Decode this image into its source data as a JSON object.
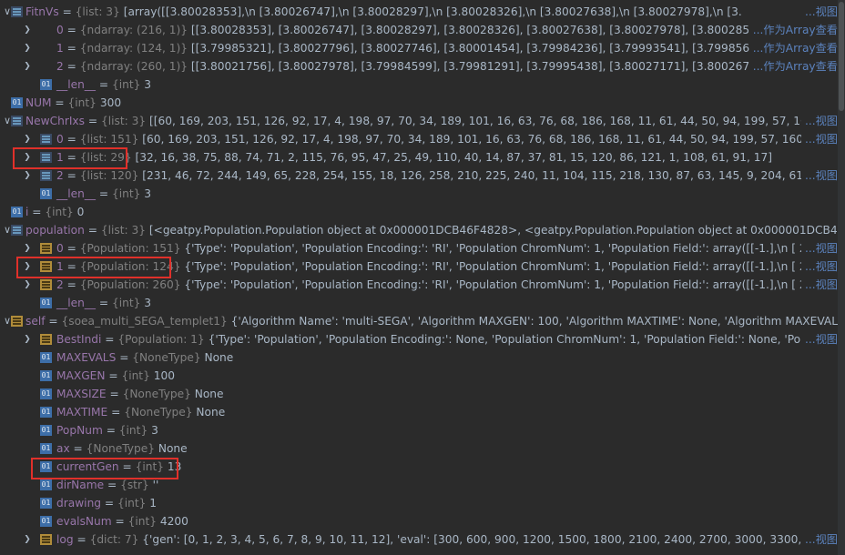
{
  "rows": [
    {
      "indent": 0,
      "expanded": true,
      "icon": "list",
      "name": "FitnVs",
      "type": "{list: 3}",
      "value": "[array([[3.80028353],\\n         [3.80026747],\\n         [3.80028297],\\n         [3.80028326],\\n         [3.80027638],\\n         [3.80027978],\\n         [3.",
      "link": "...视图"
    },
    {
      "indent": 1,
      "expanded": false,
      "icon": "array",
      "name": "0",
      "type": "{ndarray: (216, 1)}",
      "value": "[[3.80028353], [3.80026747], [3.80028297], [3.80028326], [3.80027638], [3.80027978], [3.80028574], [3.8002672",
      "link": "...作为Array查看"
    },
    {
      "indent": 1,
      "expanded": false,
      "icon": "array",
      "name": "1",
      "type": "{ndarray: (124, 1)}",
      "value": "[[3.79985321], [3.80027796], [3.80027746], [3.80001454], [3.79984236], [3.79993541], [3.7998568 ], [3.7999021 ]",
      "link": "...作为Array查看"
    },
    {
      "indent": 1,
      "expanded": false,
      "icon": "array",
      "name": "2",
      "type": "{ndarray: (260, 1)}",
      "value": "[[3.80021756], [3.80027978], [3.79984599], [3.79981291], [3.79995438], [3.80027171], [3.80026747], [3.80002302",
      "link": "...作为Array查看"
    },
    {
      "indent": 1,
      "expanded": null,
      "icon": "int",
      "name": "__len__",
      "type": "{int}",
      "value": "3",
      "link": ""
    },
    {
      "indent": 0,
      "expanded": null,
      "icon": "int",
      "name": "NUM",
      "type": "{int}",
      "value": "300",
      "link": ""
    },
    {
      "indent": 0,
      "expanded": true,
      "icon": "list",
      "name": "NewChrIxs",
      "type": "{list: 3}",
      "value": "[[60, 169, 203, 151, 126, 92, 17, 4, 198, 97, 70, 34, 189, 101, 16, 63, 76, 68, 186, 168, 11, 61, 44, 50, 94, 199, 57, 160, 10, 48, 3,",
      "link": "...视图"
    },
    {
      "indent": 1,
      "expanded": false,
      "icon": "list",
      "name": "0",
      "type": "{list: 151}",
      "value": "[60, 169, 203, 151, 126, 92, 17, 4, 198, 97, 70, 34, 189, 101, 16, 63, 76, 68, 186, 168, 11, 61, 44, 50, 94, 199, 57, 160, 10, 48, 3, 98, 1",
      "link": "...视图"
    },
    {
      "indent": 1,
      "expanded": false,
      "icon": "list",
      "name": "1",
      "type": "{list: 29}",
      "value": "[32, 16, 38, 75, 88, 74, 71, 2, 115, 76, 95, 47, 25, 49, 110, 40, 14, 87, 37, 81, 15, 120, 86, 121, 1, 108, 61, 91, 17]",
      "link": ""
    },
    {
      "indent": 1,
      "expanded": false,
      "icon": "list",
      "name": "2",
      "type": "{list: 120}",
      "value": "[231, 46, 72, 244, 149, 65, 228, 254, 155, 18, 126, 258, 210, 225, 240, 11, 104, 115, 218, 130, 87, 63, 145, 9, 204, 61, 196, 14, 157, 8",
      "link": "...视图"
    },
    {
      "indent": 1,
      "expanded": null,
      "icon": "int",
      "name": "__len__",
      "type": "{int}",
      "value": "3",
      "link": ""
    },
    {
      "indent": 0,
      "expanded": null,
      "icon": "int",
      "name": "i",
      "type": "{int}",
      "value": "0",
      "link": ""
    },
    {
      "indent": 0,
      "expanded": true,
      "icon": "list",
      "name": "population",
      "type": "{list: 3}",
      "value": "[<geatpy.Population.Population object at 0x000001DCB46F4828>, <geatpy.Population.Population object at 0x000001DCB46B4AC8",
      "link": ""
    },
    {
      "indent": 1,
      "expanded": false,
      "icon": "obj",
      "name": "0",
      "type": "{Population: 151}",
      "value": "{'Type': 'Population', 'Population Encoding:': 'RI', 'Population ChromNum': 1, 'Population Field:': array([[-1.],\\n         [ 2.],\\n",
      "link": "...视图"
    },
    {
      "indent": 1,
      "expanded": false,
      "icon": "obj",
      "name": "1",
      "type": "{Population: 124}",
      "value": "{'Type': 'Population', 'Population Encoding:': 'RI', 'Population ChromNum': 1, 'Population Field:': array([[-1.],\\n         [ 2.],\\n",
      "link": "...视图"
    },
    {
      "indent": 1,
      "expanded": false,
      "icon": "obj",
      "name": "2",
      "type": "{Population: 260}",
      "value": "{'Type': 'Population', 'Population Encoding:': 'RI', 'Population ChromNum': 1, 'Population Field:': array([[-1.],\\n         [ 2.],\\n",
      "link": "...视图"
    },
    {
      "indent": 1,
      "expanded": null,
      "icon": "int",
      "name": "__len__",
      "type": "{int}",
      "value": "3",
      "link": ""
    },
    {
      "indent": 0,
      "expanded": true,
      "icon": "obj",
      "name": "self",
      "type": "{soea_multi_SEGA_templet1}",
      "value": "{'Algorithm Name': 'multi-SEGA', 'Algorithm MAXGEN': 100, 'Algorithm MAXTIME': None, 'Algorithm MAXEVALS': None",
      "link": ""
    },
    {
      "indent": 1,
      "expanded": false,
      "icon": "obj",
      "name": "BestIndi",
      "type": "{Population: 1}",
      "value": "{'Type': 'Population', 'Population Encoding:': None, 'Population ChromNum': 1, 'Population Field:': None, 'Population",
      "link": "...视图"
    },
    {
      "indent": 1,
      "expanded": null,
      "icon": "int",
      "name": "MAXEVALS",
      "type": "{NoneType}",
      "value": "None",
      "link": ""
    },
    {
      "indent": 1,
      "expanded": null,
      "icon": "int",
      "name": "MAXGEN",
      "type": "{int}",
      "value": "100",
      "link": ""
    },
    {
      "indent": 1,
      "expanded": null,
      "icon": "int",
      "name": "MAXSIZE",
      "type": "{NoneType}",
      "value": "None",
      "link": ""
    },
    {
      "indent": 1,
      "expanded": null,
      "icon": "int",
      "name": "MAXTIME",
      "type": "{NoneType}",
      "value": "None",
      "link": ""
    },
    {
      "indent": 1,
      "expanded": null,
      "icon": "int",
      "name": "PopNum",
      "type": "{int}",
      "value": "3",
      "link": ""
    },
    {
      "indent": 1,
      "expanded": null,
      "icon": "int",
      "name": "ax",
      "type": "{NoneType}",
      "value": "None",
      "link": ""
    },
    {
      "indent": 1,
      "expanded": null,
      "icon": "int",
      "name": "currentGen",
      "type": "{int}",
      "value": "13",
      "link": ""
    },
    {
      "indent": 1,
      "expanded": null,
      "icon": "int",
      "name": "dirName",
      "type": "{str}",
      "value": "''",
      "link": ""
    },
    {
      "indent": 1,
      "expanded": null,
      "icon": "int",
      "name": "drawing",
      "type": "{int}",
      "value": "1",
      "link": ""
    },
    {
      "indent": 1,
      "expanded": null,
      "icon": "int",
      "name": "evalsNum",
      "type": "{int}",
      "value": "4200",
      "link": ""
    },
    {
      "indent": 1,
      "expanded": false,
      "icon": "dict",
      "name": "log",
      "type": "{dict: 7}",
      "value": "{'gen': [0, 1, 2, 3, 4, 5, 6, 7, 8, 9, 10, 11, 12], 'eval': [300, 600, 900, 1200, 1500, 1800, 2100, 2400, 2700, 3000, 3300, 3600, 3900], 'f_",
      "link": "...视图"
    }
  ],
  "highlights": [
    {
      "row": 8,
      "target": "newchrixs-item-1"
    },
    {
      "row": 14,
      "target": "population-item-1"
    },
    {
      "row": 25,
      "target": "current-gen"
    }
  ],
  "colors": {
    "background": "#2b2b2b",
    "name": "#9876aa",
    "type": "#808080",
    "value": "#a9b7c6",
    "newline": "#cc7832",
    "link": "#5b82bd",
    "highlight": "#e0302a"
  }
}
